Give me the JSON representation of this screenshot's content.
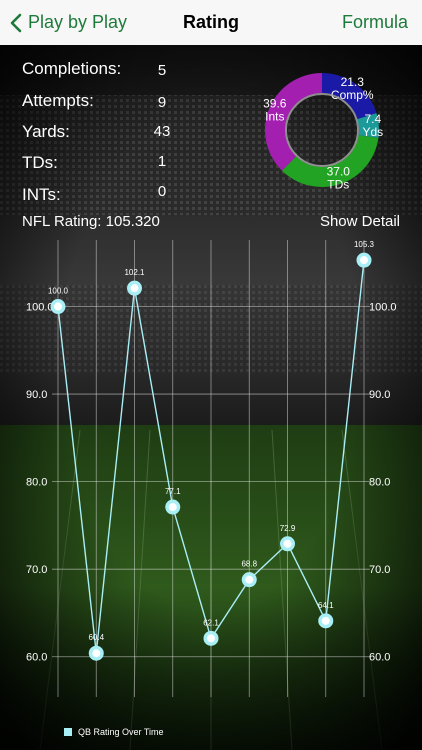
{
  "nav": {
    "back_label": "Play by Play",
    "title": "Rating",
    "right_label": "Formula"
  },
  "stats": [
    {
      "label": "Completions:",
      "value": "5"
    },
    {
      "label": "Attempts:",
      "value": "9"
    },
    {
      "label": "Yards:",
      "value": "43"
    },
    {
      "label": "TDs:",
      "value": "1"
    },
    {
      "label": "INTs:",
      "value": "0"
    }
  ],
  "rating_text": "NFL Rating: 105.320",
  "detail_label": "Show Detail",
  "donut": {
    "segments": [
      {
        "value": 21.3,
        "label": "Comp%",
        "color": "#1b1aa6"
      },
      {
        "value": 7.4,
        "label": "Yds",
        "color": "#1c9a9a"
      },
      {
        "value": 37.0,
        "label": "TDs",
        "color": "#23a324"
      },
      {
        "value": 39.6,
        "label": "Ints",
        "color": "#a21fb0"
      }
    ]
  },
  "chart_data": {
    "type": "line",
    "series": [
      {
        "name": "QB Rating Over Time",
        "values": [
          100.0,
          60.4,
          102.1,
          77.1,
          62.1,
          68.8,
          72.9,
          64.1,
          105.3
        ],
        "color": "#a8eef5"
      }
    ],
    "data_labels": [
      "100.0",
      "60.4",
      "102.1",
      "77.1",
      "62.1",
      "68.8",
      "72.9",
      "64.1",
      "105.3"
    ],
    "y_ticks": [
      "100.0",
      "90.0",
      "80.0",
      "70.0",
      "60.0"
    ],
    "y_tick_values": [
      100,
      90,
      80,
      70,
      60
    ],
    "ylim": [
      55.4,
      107.6
    ],
    "grid": true,
    "legend": "bottom-left"
  }
}
